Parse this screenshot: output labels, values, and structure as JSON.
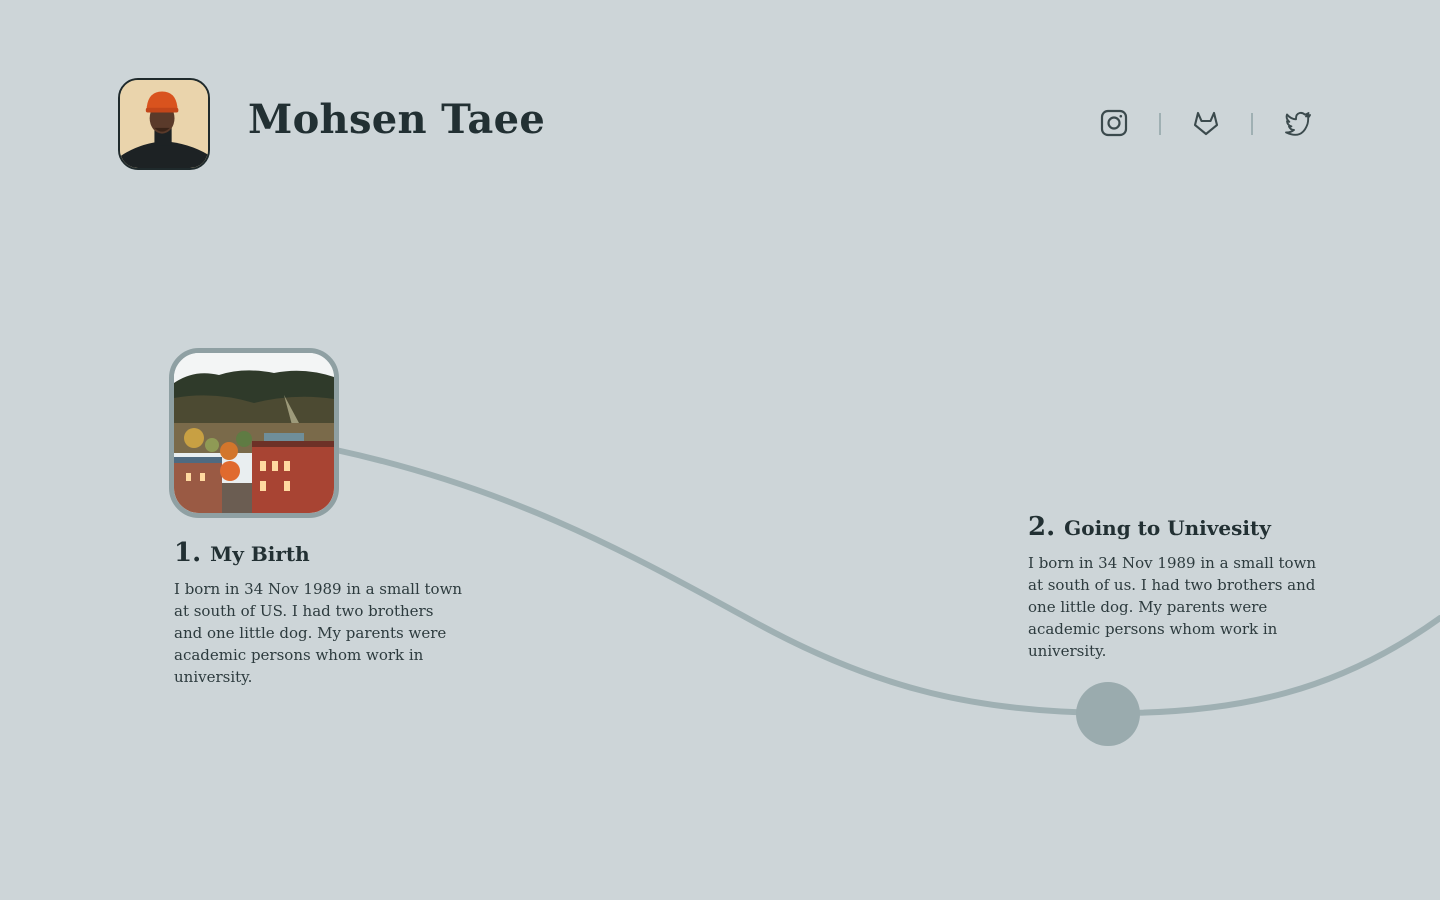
{
  "header": {
    "title": "Mohsen Taee",
    "avatar_icon": "user-avatar-photo",
    "social": [
      {
        "name": "instagram",
        "icon": "instagram-icon"
      },
      {
        "name": "gitlab",
        "icon": "gitlab-icon"
      },
      {
        "name": "twitter",
        "icon": "twitter-icon"
      }
    ]
  },
  "timeline": {
    "line_color": "#9fb0b3",
    "milestones": [
      {
        "number": "1.",
        "title": "My Birth",
        "text": "I born in 34 Nov 1989 in a small town at south of US. I had two brothers and one little dog. My parents were academic persons whom work in university.",
        "image_icon": "town-photo"
      },
      {
        "number": "2.",
        "title": "Going to Univesity",
        "text": "I born in 34 Nov 1989 in a small town at south of us. I had two brothers and one little dog. My parents were academic persons whom work in university."
      }
    ]
  },
  "colors": {
    "background": "#cdd5d8",
    "text": "#223033",
    "accent": "#9fb0b3"
  }
}
